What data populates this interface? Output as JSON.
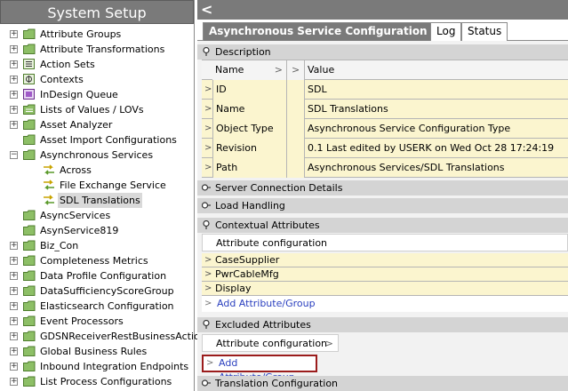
{
  "left_panel": {
    "title": "System Setup",
    "tree": [
      {
        "label": "Attribute Groups",
        "icon": "folder-icon",
        "expander": "+"
      },
      {
        "label": "Attribute Transformations",
        "icon": "folder-icon",
        "expander": "+"
      },
      {
        "label": "Action Sets",
        "icon": "action-set-icon",
        "expander": "+"
      },
      {
        "label": "Contexts",
        "icon": "contexts-icon",
        "expander": "+"
      },
      {
        "label": "InDesign Queue",
        "icon": "indesign-icon",
        "expander": "+"
      },
      {
        "label": "Lists of Values / LOVs",
        "icon": "folder-list-icon",
        "expander": "+"
      },
      {
        "label": "Asset Analyzer",
        "icon": "folder-icon",
        "expander": "+"
      },
      {
        "label": "Asset Import Configurations",
        "icon": "folder-icon",
        "expander": ""
      },
      {
        "label": "Asynchronous Services",
        "icon": "folder-icon",
        "expander": "-"
      },
      {
        "label": "Across",
        "icon": "service-arrows-icon",
        "expander": ""
      },
      {
        "label": "File Exchange Service",
        "icon": "service-arrows-icon",
        "expander": ""
      },
      {
        "label": "SDL Translations",
        "icon": "service-arrows-icon",
        "expander": "",
        "selected": true
      },
      {
        "label": "AsyncServices",
        "icon": "folder-icon",
        "expander": ""
      },
      {
        "label": "AsynService819",
        "icon": "folder-icon",
        "expander": ""
      },
      {
        "label": "Biz_Con",
        "icon": "folder-icon",
        "expander": "+"
      },
      {
        "label": "Completeness Metrics",
        "icon": "folder-icon",
        "expander": "+"
      },
      {
        "label": "Data Profile Configuration",
        "icon": "folder-icon",
        "expander": "+"
      },
      {
        "label": "DataSufficiencyScoreGroup",
        "icon": "folder-icon",
        "expander": "+"
      },
      {
        "label": "Elasticsearch Configuration",
        "icon": "folder-icon",
        "expander": "+"
      },
      {
        "label": "Event Processors",
        "icon": "folder-icon",
        "expander": "+"
      },
      {
        "label": "GDSNReceiverRestBusinessActions",
        "icon": "folder-icon",
        "expander": "+"
      },
      {
        "label": "Global Business Rules",
        "icon": "folder-icon",
        "expander": "+"
      },
      {
        "label": "Inbound Integration Endpoints",
        "icon": "folder-icon",
        "expander": "+"
      },
      {
        "label": "List Process Configurations",
        "icon": "folder-icon",
        "expander": "+"
      }
    ]
  },
  "right_panel": {
    "back_glyph": "<",
    "tabs": [
      {
        "label": "Asynchronous Service Configuration Type",
        "active": true
      },
      {
        "label": "Log",
        "active": false
      },
      {
        "label": "Status",
        "active": false
      }
    ],
    "sections": {
      "description": "Description",
      "server_connection": "Server Connection Details",
      "load_handling": "Load Handling",
      "contextual_attributes": "Contextual Attributes",
      "excluded_attributes": "Excluded Attributes",
      "translation_configuration": "Translation Configuration"
    },
    "description_grid": {
      "header": {
        "name": "Name",
        "value": "Value"
      },
      "rows": [
        {
          "name": "ID",
          "value": "SDL"
        },
        {
          "name": "Name",
          "value": "SDL Translations"
        },
        {
          "name": "Object Type",
          "value": "Asynchronous Service Configuration Type"
        },
        {
          "name": "Revision",
          "value": "0.1 Last edited by USERK on Wed Oct 28 17:24:19 EDT 2020"
        },
        {
          "name": "Path",
          "value": "Asynchronous Services/SDL Translations"
        }
      ]
    },
    "contextual": {
      "header": "Attribute configuration",
      "items": [
        "CaseSupplier",
        "PwrCableMfg",
        "Display"
      ],
      "add_link": "Add Attribute/Group"
    },
    "excluded": {
      "header": "Attribute configuration",
      "add_link": "Add Attribute/Group",
      "highlight_color": "#9b1c1c"
    }
  }
}
